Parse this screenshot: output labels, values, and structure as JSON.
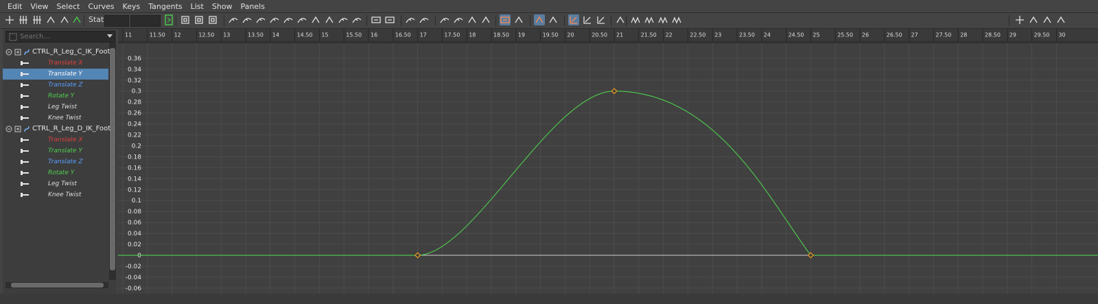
{
  "menu": [
    "Edit",
    "View",
    "Select",
    "Curves",
    "Keys",
    "Tangents",
    "List",
    "Show",
    "Panels"
  ],
  "toolbar": {
    "stats_label": "Stats"
  },
  "outliner": {
    "search_placeholder": "Search...",
    "nodes": [
      {
        "name": "CTRL_R_Leg_C_IK_Foot",
        "attrs": [
          {
            "label": "Translate X",
            "color": "#e04040"
          },
          {
            "label": "Translate Y",
            "color": "#ffffff",
            "selected": true
          },
          {
            "label": "Translate Z",
            "color": "#5aa0ff"
          },
          {
            "label": "Rotate Y",
            "color": "#4fd04f"
          },
          {
            "label": "Leg Twist",
            "color": "#dddddd"
          },
          {
            "label": "Knee Twist",
            "color": "#dddddd"
          }
        ]
      },
      {
        "name": "CTRL_R_Leg_D_IK_Foot",
        "attrs": [
          {
            "label": "Translate X",
            "color": "#e04040"
          },
          {
            "label": "Translate Y",
            "color": "#4fd04f"
          },
          {
            "label": "Translate Z",
            "color": "#5aa0ff"
          },
          {
            "label": "Rotate Y",
            "color": "#4fd04f"
          },
          {
            "label": "Leg Twist",
            "color": "#dddddd"
          },
          {
            "label": "Knee Twist",
            "color": "#dddddd"
          }
        ]
      }
    ]
  },
  "graph": {
    "time_ticks": [
      "11",
      "11.50",
      "12",
      "12.50",
      "13",
      "13.50",
      "14",
      "14.50",
      "15",
      "15.50",
      "16",
      "16.50",
      "17",
      "17.50",
      "18",
      "18.50",
      "19",
      "19.50",
      "20",
      "20.50",
      "21",
      "21.50",
      "22",
      "22.50",
      "23",
      "23.50",
      "24",
      "24.50",
      "25",
      "25.50",
      "26",
      "26.50",
      "27",
      "27.50",
      "28",
      "28.50",
      "29",
      "29.50",
      "30"
    ],
    "value_ticks": [
      "0.36",
      "0.34",
      "0.32",
      "0.3",
      "0.28",
      "0.26",
      "0.24",
      "0.22",
      "0.2",
      "0.18",
      "0.16",
      "0.14",
      "0.12",
      "0.1",
      "0.08",
      "0.06",
      "0.04",
      "0.02",
      "0",
      "-0.02",
      "-0.04",
      "-0.06"
    ],
    "curve_color": "#4cc24c",
    "key_color": "#f0a020",
    "keys": [
      {
        "frame": 17,
        "value": 0
      },
      {
        "frame": 21,
        "value": 0.3
      },
      {
        "frame": 25,
        "value": 0
      }
    ],
    "x_range": [
      11,
      30
    ],
    "y_range": [
      -0.06,
      0.36
    ]
  }
}
